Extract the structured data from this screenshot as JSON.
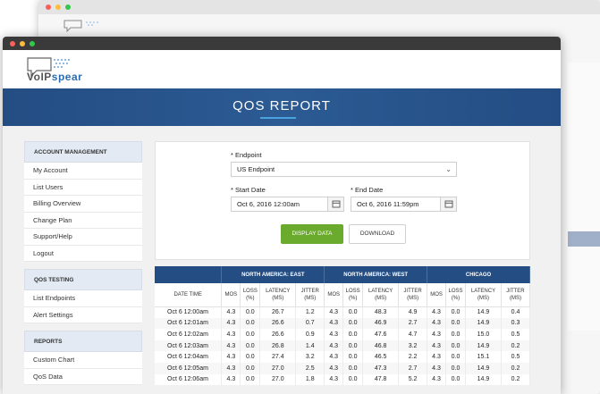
{
  "app": {
    "logo_text_a": "VoIP",
    "logo_text_b": "spear",
    "banner_title": "QOS REPORT"
  },
  "sidebar": {
    "sections": [
      {
        "title": "ACCOUNT MANAGEMENT",
        "items": [
          "My Account",
          "List Users",
          "Billing Overview",
          "Change Plan",
          "Support/Help",
          "Logout"
        ]
      },
      {
        "title": "QOS TESTING",
        "items": [
          "List Endpoints",
          "Alert Settings"
        ]
      },
      {
        "title": "REPORTS",
        "items": [
          "Custom Chart",
          "QoS Data"
        ]
      }
    ]
  },
  "form": {
    "endpoint_label": "* Endpoint",
    "endpoint_value": "US Endpoint",
    "start_label": "* Start Date",
    "start_value": "Oct 6, 2016 12:00am",
    "end_label": "* End Date",
    "end_value": "Oct 6, 2016 11:59pm",
    "display_button": "DISPLAY DATA",
    "download_button": "DOWNLOAD"
  },
  "table": {
    "groups": [
      "NORTH AMERICA: EAST",
      "NORTH AMERICA: WEST",
      "CHICAGO"
    ],
    "date_header": "DATE TIME",
    "metric_headers": [
      "MOS",
      "LOSS (%)",
      "LATENCY (MS)",
      "JITTER (MS)"
    ],
    "rows": [
      [
        "Oct 6 12:00am",
        "4.3",
        "0.0",
        "26.7",
        "1.2",
        "4.3",
        "0.0",
        "48.3",
        "4.9",
        "4.3",
        "0.0",
        "14.9",
        "0.4"
      ],
      [
        "Oct 6 12:01am",
        "4.3",
        "0.0",
        "26.6",
        "0.7",
        "4.3",
        "0.0",
        "46.9",
        "2.7",
        "4.3",
        "0.0",
        "14.9",
        "0.3"
      ],
      [
        "Oct 6 12:02am",
        "4.3",
        "0.0",
        "26.6",
        "0.9",
        "4.3",
        "0.0",
        "47.6",
        "4.7",
        "4.3",
        "0.0",
        "15.0",
        "0.5"
      ],
      [
        "Oct 6 12:03am",
        "4.3",
        "0.0",
        "26.8",
        "1.4",
        "4.3",
        "0.0",
        "46.8",
        "3.2",
        "4.3",
        "0.0",
        "14.9",
        "0.2"
      ],
      [
        "Oct 6 12:04am",
        "4.3",
        "0.0",
        "27.4",
        "3.2",
        "4.3",
        "0.0",
        "46.5",
        "2.2",
        "4.3",
        "0.0",
        "15.1",
        "0.5"
      ],
      [
        "Oct 6 12:05am",
        "4.3",
        "0.0",
        "27.0",
        "2.5",
        "4.3",
        "0.0",
        "47.3",
        "2.7",
        "4.3",
        "0.0",
        "14.9",
        "0.2"
      ],
      [
        "Oct 6 12:06am",
        "4.3",
        "0.0",
        "27.0",
        "1.8",
        "4.3",
        "0.0",
        "47.8",
        "5.2",
        "4.3",
        "0.0",
        "14.9",
        "0.2"
      ]
    ]
  },
  "colors": {
    "brand_blue": "#234d83",
    "accent_green": "#6aaa2c",
    "logo_blue": "#2a6db5"
  }
}
